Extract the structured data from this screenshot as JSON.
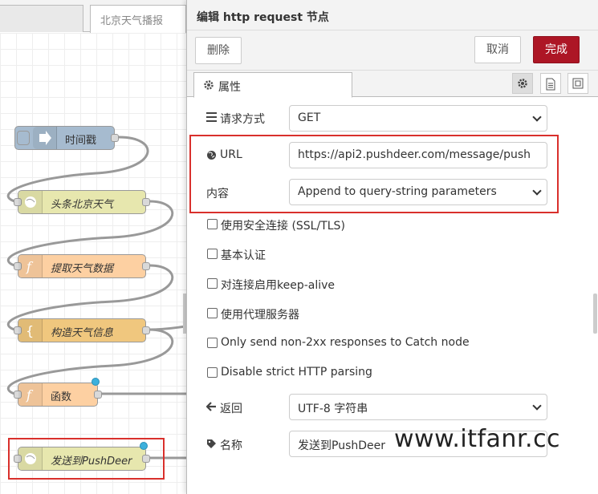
{
  "workspace": {
    "tabs": [
      "",
      "北京天气播报"
    ],
    "nodes": {
      "time": "时间戳",
      "weather": "头条北京天气",
      "extract": "提取天气数据",
      "build": "构造天气信息",
      "func": "函数",
      "send": "发送到PushDeer"
    }
  },
  "tray": {
    "title": "编辑 http request 节点",
    "delete_label": "删除",
    "cancel_label": "取消",
    "done_label": "完成",
    "tab_properties": "属性",
    "accent": "#ad1625"
  },
  "form": {
    "method_label": "请求方式",
    "method_value": "GET",
    "url_label": "URL",
    "url_value": "https://api2.pushdeer.com/message/push",
    "payload_label": "内容",
    "payload_value": "Append to query-string parameters",
    "checks": [
      "使用安全连接 (SSL/TLS)",
      "基本认证",
      "对连接启用keep-alive",
      "使用代理服务器",
      "Only send non-2xx responses to Catch node",
      "Disable strict HTTP parsing"
    ],
    "return_label": "返回",
    "return_value": "UTF-8 字符串",
    "name_label": "名称",
    "name_value": "发送到PushDeer"
  },
  "watermark": "www.itfanr.cc"
}
